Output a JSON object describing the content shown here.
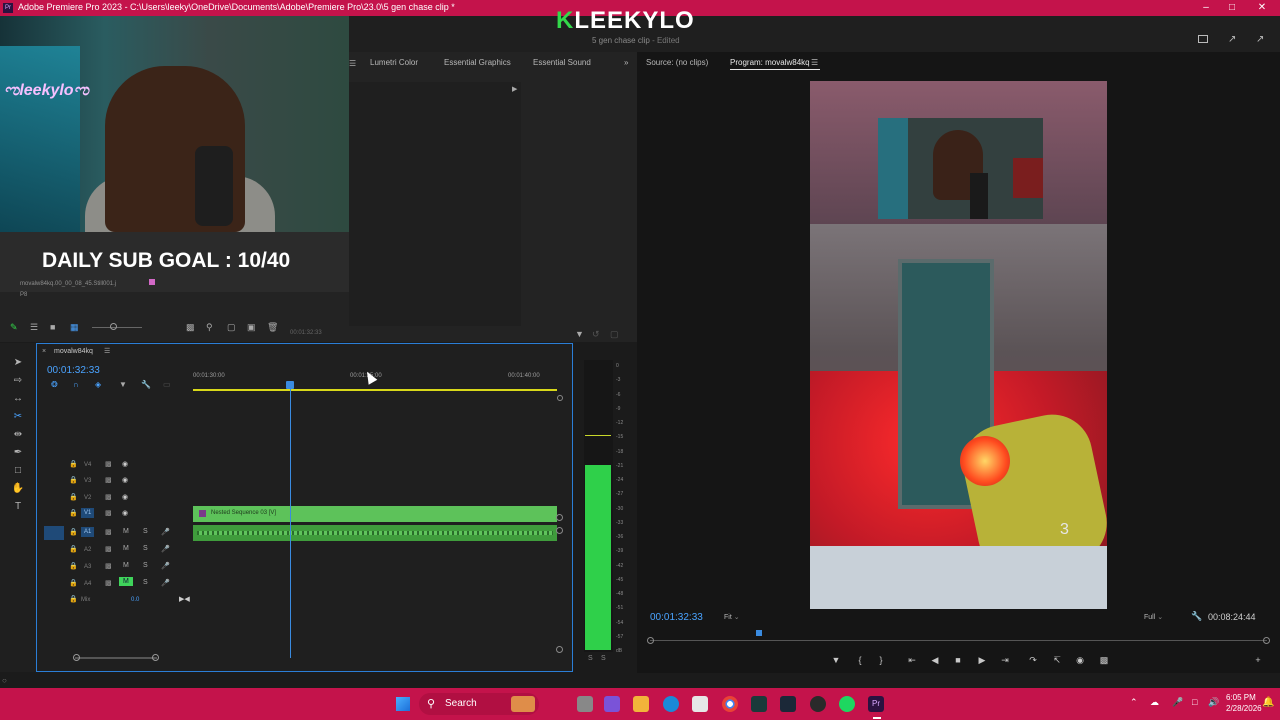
{
  "window": {
    "title": "Adobe Premiere Pro 2023 - C:\\Users\\leeky\\OneDrive\\Documents\\Adobe\\Premiere Pro\\23.0\\5 gen chase clip *",
    "app_badge": "Pr"
  },
  "header": {
    "logo_k": "K",
    "logo_text": "LEEKYLO",
    "project_name": "5 gen chase clip",
    "project_status": "- Edited"
  },
  "overlay": {
    "sub_goal": "DAILY SUB GOAL : 10/40",
    "webcam_sticker": "ಌleekyloಌ"
  },
  "project_panel": {
    "clip_name": "movalw84kq.00_00_08_45.Still001.j",
    "clip_sub": "P8",
    "timecode": "00:01:32:33"
  },
  "effects_panel": {
    "tabs": [
      "Lumetri Color",
      "Essential Graphics",
      "Essential Sound"
    ],
    "more": "»"
  },
  "timeline": {
    "sequence_name": "movalw84kq",
    "timecode": "00:01:32:33",
    "ruler_labels": [
      "00:01:30:00",
      "00:01:35:00",
      "00:01:40:00"
    ],
    "video_tracks": [
      "V4",
      "V3",
      "V2",
      "V1"
    ],
    "audio_tracks": [
      "A1",
      "A2",
      "A3",
      "A4"
    ],
    "mix_label": "Mix",
    "mix_value": "0.0",
    "clip_label": "Nested Sequence 03 [V]",
    "mute": "M",
    "solo": "S",
    "vu_ticks": [
      "0",
      "-3",
      "-6",
      "-9",
      "-12",
      "-15",
      "-18",
      "-21",
      "-24",
      "-27",
      "-30",
      "-33",
      "-36",
      "-39",
      "-42",
      "-45",
      "-48",
      "-51",
      "-54",
      "-57",
      "dB"
    ],
    "vu_solo": [
      "S",
      "S"
    ]
  },
  "program_monitor": {
    "source_tab": "Source: (no clips)",
    "program_tab": "Program: movalw84kq",
    "timecode": "00:01:32:33",
    "fit": "Fit",
    "quality": "Full",
    "duration": "00:08:24:44",
    "overlay_number": "3"
  },
  "taskbar": {
    "search_label": "Search",
    "time": "6:05 PM",
    "date": "2/28/2026"
  },
  "colors": {
    "accent_blue": "#2b7ed6",
    "timecode_blue": "#4aa3ff",
    "clip_green": "#5dc25a",
    "taskbar": "#c4134b"
  }
}
